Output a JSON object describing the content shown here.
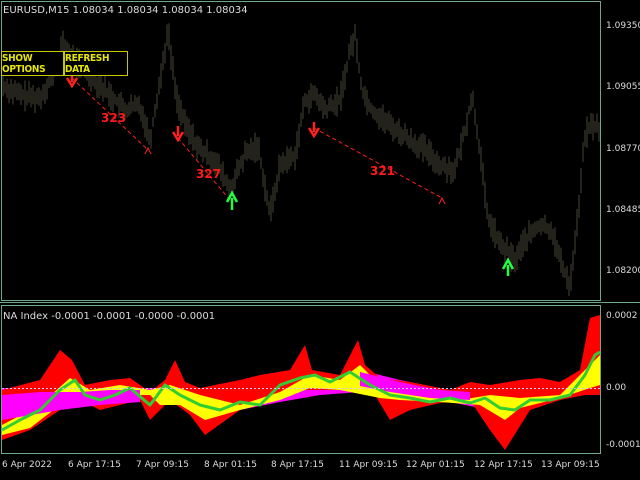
{
  "symbol": "EURUSD,M15  1.08034 1.08034 1.08034 1.08034",
  "buttons": {
    "show_options": "SHOW OPTIONS",
    "refresh_data": "REFRESH DATA"
  },
  "indicator_label": "NA Index -0.0001 -0.0001 -0.0000 -0.0001",
  "price_axis": [
    "1.09350",
    "1.09055",
    "1.08770",
    "1.08485",
    "1.08200"
  ],
  "indicator_axis": [
    "0.0002",
    "0.00",
    "-0.0001"
  ],
  "time_axis": [
    "6 Apr 2022",
    "6 Apr 17:15",
    "7 Apr 09:15",
    "8 Apr 01:15",
    "8 Apr 17:15",
    "11 Apr 09:15",
    "12 Apr 01:15",
    "12 Apr 17:15",
    "13 Apr 09:15"
  ],
  "pip_counts": [
    "323",
    "327",
    "321"
  ],
  "colors": {
    "background": "#000000",
    "frame": "#6fa88a",
    "candles": "#3b3b2e",
    "down_arrow": "#ff2020",
    "up_arrow": "#20ff40",
    "trend_line": "#ff2020",
    "magenta": "#ff00ff",
    "yellow": "#ffff00",
    "red": "#ff0000",
    "green_line": "#32cd32"
  }
}
